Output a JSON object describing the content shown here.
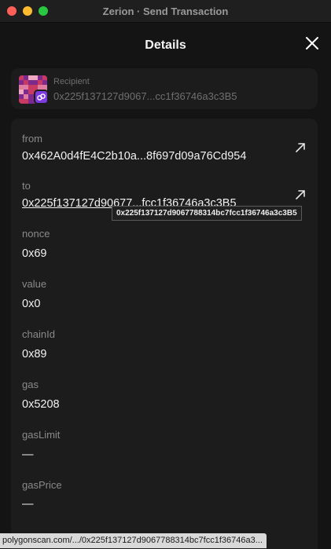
{
  "window": {
    "title": "Zerion · Send Transaction"
  },
  "header": {
    "title": "Details"
  },
  "recipient": {
    "label": "Recipient",
    "address": "0x225f137127d9067...cc1f36746a3c3B5",
    "avatar_colors": [
      "#c83a63",
      "#7e2a8d",
      "#e07ca0",
      "#f0a9c2"
    ],
    "network_badge_color": "#7c3ae0"
  },
  "details": {
    "fields": [
      {
        "label": "from",
        "value": "0x462A0d4fE4C2b10a...8f697d09a76Cd954"
      },
      {
        "label": "to",
        "value": "0x225f137127d90677...fcc1f36746a3c3B5"
      },
      {
        "label": "nonce",
        "value": "0x69"
      },
      {
        "label": "value",
        "value": "0x0"
      },
      {
        "label": "chainId",
        "value": "0x89"
      },
      {
        "label": "gas",
        "value": "0x5208"
      },
      {
        "label": "gasLimit",
        "value": "—"
      },
      {
        "label": "gasPrice",
        "value": "—"
      }
    ]
  },
  "tooltip": {
    "text": "0x225f137127d9067788314bc7fcc1f36746a3c3B5"
  },
  "statusbar": {
    "url": "polygonscan.com/.../0x225f137127d9067788314bc7fcc1f36746a3..."
  },
  "icons": {
    "close": "close-icon",
    "external_link": "external-link-icon",
    "network": "link-icon"
  }
}
